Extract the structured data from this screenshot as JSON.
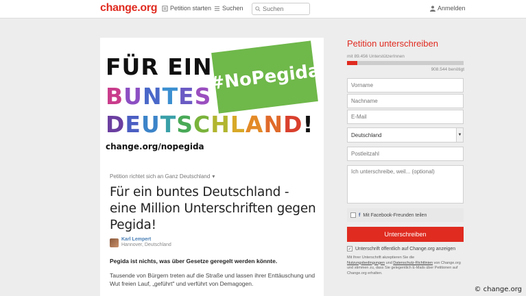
{
  "header": {
    "logo": "change.org",
    "nav_start": "Petition starten",
    "nav_search": "Suchen",
    "search_placeholder": "Suchen",
    "login": "Anmelden"
  },
  "hero": {
    "line1": "FÜR EIN",
    "line2_letters": [
      {
        "ch": "B",
        "color": "#c93c8b"
      },
      {
        "ch": "U",
        "color": "#8c4fc2"
      },
      {
        "ch": "N",
        "color": "#4a68c9"
      },
      {
        "ch": "T",
        "color": "#3b8fd0"
      },
      {
        "ch": "E",
        "color": "#6a5bc4"
      },
      {
        "ch": "S",
        "color": "#9a4fbf"
      }
    ],
    "line3_letters": [
      {
        "ch": "D",
        "color": "#6b3fa0"
      },
      {
        "ch": "E",
        "color": "#4b5ec2"
      },
      {
        "ch": "U",
        "color": "#3c84c9"
      },
      {
        "ch": "T",
        "color": "#3aa0a8"
      },
      {
        "ch": "S",
        "color": "#49a957"
      },
      {
        "ch": "C",
        "color": "#7ab33c"
      },
      {
        "ch": "H",
        "color": "#b1b52f"
      },
      {
        "ch": "L",
        "color": "#d8a928"
      },
      {
        "ch": "A",
        "color": "#e38a27"
      },
      {
        "ch": "N",
        "color": "#e06a2a"
      },
      {
        "ch": "D",
        "color": "#d9402d"
      },
      {
        "ch": "!",
        "color": "#111111"
      }
    ],
    "badge": "#NoPegida",
    "url": "change.org/nopegida"
  },
  "petition": {
    "target": "Petition richtet sich an Ganz Deutschland",
    "title": "Für ein buntes Deutschland - eine Million Unterschriften gegen Pegida!",
    "author_name": "Karl Lempert",
    "author_location": "Hannover, Deutschland",
    "lead": "Pegida ist nichts, was über Gesetze geregelt werden könnte.",
    "body": "Tausende von Bürgern treten auf die Straße und lassen ihrer Enttäuschung und Wut freien Lauf, „geführt\" und verführt von Demagogen."
  },
  "sign": {
    "title": "Petition unterschreiben",
    "count": "mit 89.456 UnterstützerInnen",
    "needed": "908.544 benötigt",
    "progress": 0.09,
    "firstname_placeholder": "Vorname",
    "lastname_placeholder": "Nachname",
    "email_placeholder": "E-Mail",
    "country": "Deutschland",
    "zip_placeholder": "Postleitzahl",
    "reason_placeholder": "Ich unterschreibe, weil... (optional)",
    "facebook_label": "Mit Facebook-Freunden teilen",
    "button": "Unterschreiben",
    "public_label": "Unterschrift öffentlich auf Change.org anzeigen",
    "legal_1": "Mit Ihrer Unterschrift akzeptieren Sie die",
    "legal_link1": "Nutzungsbedingungen",
    "legal_and": "und",
    "legal_link2": "Datenschutz-Richtlinien",
    "legal_2": "von Change.org und stimmen zu, dass Sie gelegentlich E-Mails über Petitionen auf Change.org erhalten."
  },
  "credit": "© change.org",
  "colors": {
    "accent": "#e02b20",
    "badge": "#6fb84a"
  }
}
